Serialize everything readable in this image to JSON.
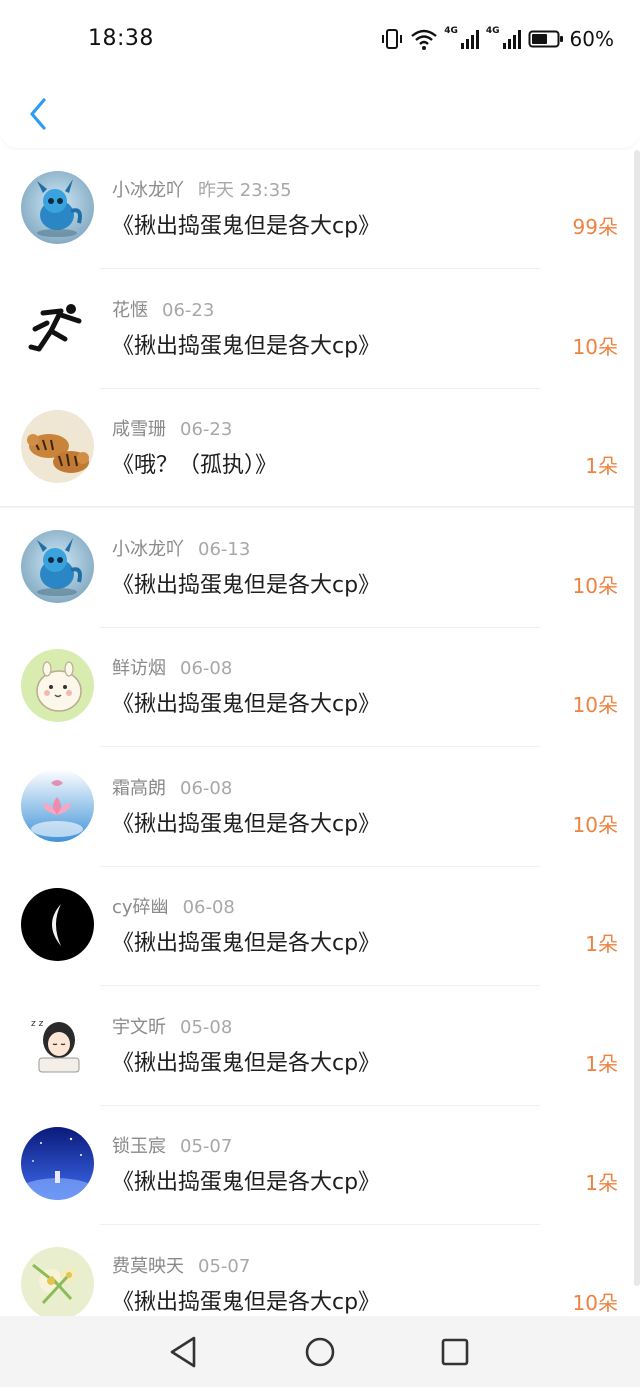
{
  "status_bar": {
    "time": "18:38",
    "battery_percent": "60%",
    "network_left": "4G",
    "network_right": "4G",
    "icons": [
      "vibrate-icon",
      "wifi-icon",
      "signal-icon",
      "signal-icon",
      "battery-icon"
    ]
  },
  "header": {
    "back_icon": "chevron-left-icon"
  },
  "colors": {
    "accent_blue": "#2f9bf5",
    "count_orange": "#ef8240",
    "meta_gray": "#8a8a8a"
  },
  "items": [
    {
      "name": "小冰龙吖",
      "date": "昨天 23:35",
      "title": "《揪出捣蛋鬼但是各大cp》",
      "count": "99朵",
      "avatar": "dragon"
    },
    {
      "name": "花惬",
      "date": "06-23",
      "title": "《揪出捣蛋鬼但是各大cp》",
      "count": "10朵",
      "avatar": "runner"
    },
    {
      "name": "咸雪珊",
      "date": "06-23",
      "title": "《哦？（孤执）》",
      "count": "1朵",
      "avatar": "tigers"
    },
    {
      "name": "小冰龙吖",
      "date": "06-13",
      "title": "《揪出捣蛋鬼但是各大cp》",
      "count": "10朵",
      "avatar": "dragon"
    },
    {
      "name": "鲜访烟",
      "date": "06-08",
      "title": "《揪出捣蛋鬼但是各大cp》",
      "count": "10朵",
      "avatar": "alpaca"
    },
    {
      "name": "霜高朗",
      "date": "06-08",
      "title": "《揪出捣蛋鬼但是各大cp》",
      "count": "10朵",
      "avatar": "lotus"
    },
    {
      "name": "cy碎幽",
      "date": "06-08",
      "title": "《揪出捣蛋鬼但是各大cp》",
      "count": "1朵",
      "avatar": "moon"
    },
    {
      "name": "宇文昕",
      "date": "05-08",
      "title": "《揪出捣蛋鬼但是各大cp》",
      "count": "1朵",
      "avatar": "girl"
    },
    {
      "name": "锁玉宸",
      "date": "05-07",
      "title": "《揪出捣蛋鬼但是各大cp》",
      "count": "1朵",
      "avatar": "night"
    },
    {
      "name": "费莫映天",
      "date": "05-07",
      "title": "《揪出捣蛋鬼但是各大cp》",
      "count": "10朵",
      "avatar": "flowers"
    }
  ],
  "nav_bar": {
    "buttons": [
      "back-triangle-icon",
      "home-circle-icon",
      "recents-square-icon"
    ]
  }
}
